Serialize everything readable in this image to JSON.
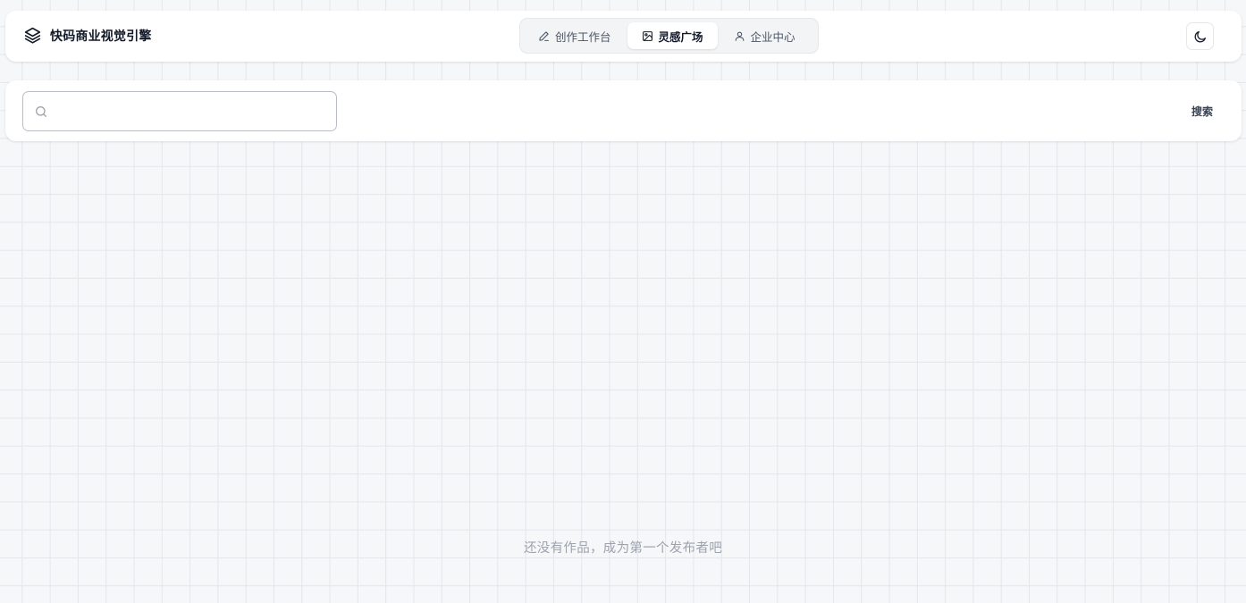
{
  "header": {
    "brand_icon": "layers-icon",
    "brand_title": "快码商业视觉引擎",
    "tabs": [
      {
        "label": "创作工作台",
        "icon": "pencil-icon",
        "active": false
      },
      {
        "label": "灵感广场",
        "icon": "image-icon",
        "active": true
      },
      {
        "label": "企业中心",
        "icon": "user-icon",
        "active": false
      }
    ],
    "theme_toggle_icon": "moon-icon"
  },
  "search": {
    "icon": "search-icon",
    "value": "",
    "button_label": "搜索"
  },
  "empty_state": {
    "message": "还没有作品，成为第一个发布者吧"
  },
  "colors": {
    "page_background": "#f6f7f9",
    "grid_line": "#e3e6ea",
    "card_background": "#ffffff",
    "text_primary": "#111827",
    "text_muted": "#9ca3af",
    "border": "#e5e7eb"
  }
}
